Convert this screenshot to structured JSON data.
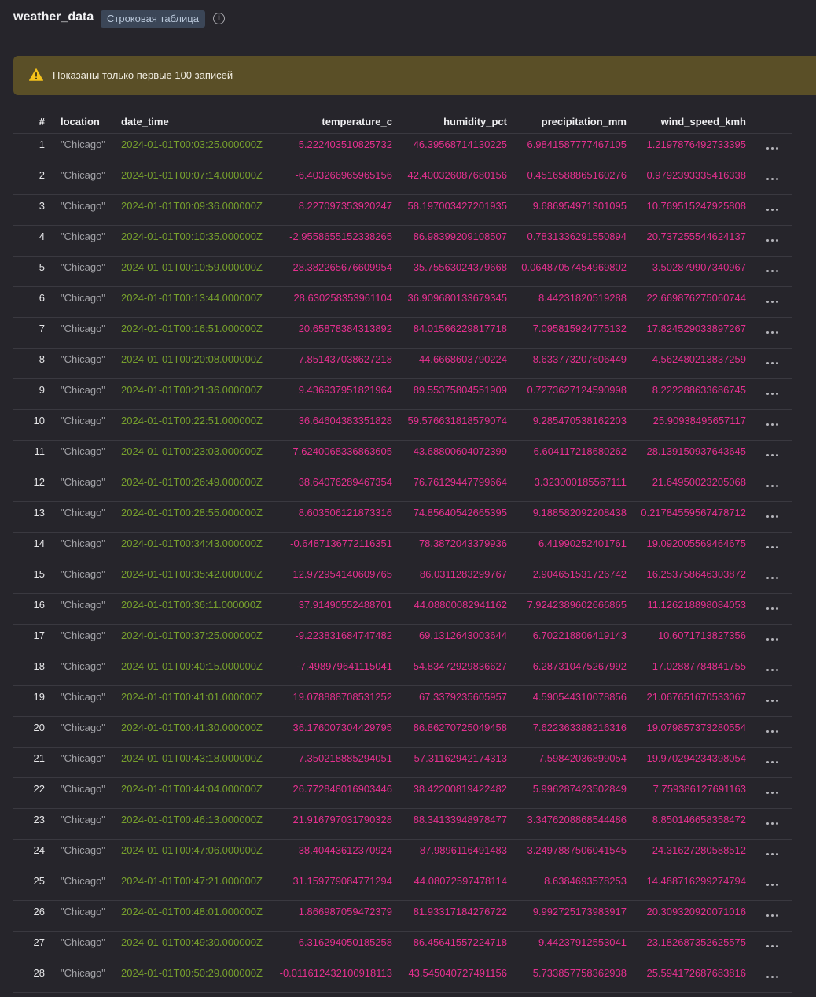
{
  "header": {
    "title": "weather_data",
    "badge": "Строковая таблица",
    "info_icon": "info-circle-icon"
  },
  "banner": {
    "icon": "warning-triangle-icon",
    "text": "Показаны только первые 100 записей",
    "color": "#5a4f27"
  },
  "colors": {
    "string": "#a3a3a8",
    "datetime": "#77a02d",
    "number": "#e5308f"
  },
  "table": {
    "columns": [
      "#",
      "location",
      "date_time",
      "temperature_c",
      "humidity_pct",
      "precipitation_mm",
      "wind_speed_kmh"
    ],
    "rows": [
      [
        "1",
        "\"Chicago\"",
        "2024-01-01T00:03:25.000000Z",
        "5.222403510825732",
        "46.39568714130225",
        "6.9841587777467105",
        "1.2197876492733395"
      ],
      [
        "2",
        "\"Chicago\"",
        "2024-01-01T00:07:14.000000Z",
        "-6.403266965965156",
        "42.400326087680156",
        "0.4516588865160276",
        "0.9792393335416338"
      ],
      [
        "3",
        "\"Chicago\"",
        "2024-01-01T00:09:36.000000Z",
        "8.227097353920247",
        "58.197003427201935",
        "9.686954971301095",
        "10.769515247925808"
      ],
      [
        "4",
        "\"Chicago\"",
        "2024-01-01T00:10:35.000000Z",
        "-2.9558655152338265",
        "86.98399209108507",
        "0.7831336291550894",
        "20.737255544624137"
      ],
      [
        "5",
        "\"Chicago\"",
        "2024-01-01T00:10:59.000000Z",
        "28.382265676609954",
        "35.75563024379668",
        "0.06487057454969802",
        "3.502879907340967"
      ],
      [
        "6",
        "\"Chicago\"",
        "2024-01-01T00:13:44.000000Z",
        "28.630258353961104",
        "36.909680133679345",
        "8.44231820519288",
        "22.669876275060744"
      ],
      [
        "7",
        "\"Chicago\"",
        "2024-01-01T00:16:51.000000Z",
        "20.65878384313892",
        "84.01566229817718",
        "7.095815924775132",
        "17.824529033897267"
      ],
      [
        "8",
        "\"Chicago\"",
        "2024-01-01T00:20:08.000000Z",
        "7.851437038627218",
        "44.6668603790224",
        "8.633773207606449",
        "4.562480213837259"
      ],
      [
        "9",
        "\"Chicago\"",
        "2024-01-01T00:21:36.000000Z",
        "9.436937951821964",
        "89.55375804551909",
        "0.7273627124590998",
        "8.222288633686745"
      ],
      [
        "10",
        "\"Chicago\"",
        "2024-01-01T00:22:51.000000Z",
        "36.64604383351828",
        "59.576631818579074",
        "9.285470538162203",
        "25.90938495657117"
      ],
      [
        "11",
        "\"Chicago\"",
        "2024-01-01T00:23:03.000000Z",
        "-7.6240068336863605",
        "43.68800604072399",
        "6.604117218680262",
        "28.139150937643645"
      ],
      [
        "12",
        "\"Chicago\"",
        "2024-01-01T00:26:49.000000Z",
        "38.64076289467354",
        "76.76129447799664",
        "3.323000185567111",
        "21.64950023205068"
      ],
      [
        "13",
        "\"Chicago\"",
        "2024-01-01T00:28:55.000000Z",
        "8.603506121873316",
        "74.85640542665395",
        "9.188582092208438",
        "0.21784559567478712"
      ],
      [
        "14",
        "\"Chicago\"",
        "2024-01-01T00:34:43.000000Z",
        "-0.6487136772116351",
        "78.3872043379936",
        "6.41990252401761",
        "19.092005569464675"
      ],
      [
        "15",
        "\"Chicago\"",
        "2024-01-01T00:35:42.000000Z",
        "12.972954140609765",
        "86.0311283299767",
        "2.904651531726742",
        "16.253758646303872"
      ],
      [
        "16",
        "\"Chicago\"",
        "2024-01-01T00:36:11.000000Z",
        "37.91490552488701",
        "44.08800082941162",
        "7.9242389602666865",
        "11.126218898084053"
      ],
      [
        "17",
        "\"Chicago\"",
        "2024-01-01T00:37:25.000000Z",
        "-9.223831684747482",
        "69.1312643003644",
        "6.702218806419143",
        "10.6071713827356"
      ],
      [
        "18",
        "\"Chicago\"",
        "2024-01-01T00:40:15.000000Z",
        "-7.498979641115041",
        "54.83472929836627",
        "6.287310475267992",
        "17.02887784841755"
      ],
      [
        "19",
        "\"Chicago\"",
        "2024-01-01T00:41:01.000000Z",
        "19.078888708531252",
        "67.3379235605957",
        "4.590544310078856",
        "21.067651670533067"
      ],
      [
        "20",
        "\"Chicago\"",
        "2024-01-01T00:41:30.000000Z",
        "36.176007304429795",
        "86.86270725049458",
        "7.622363388216316",
        "19.079857373280554"
      ],
      [
        "21",
        "\"Chicago\"",
        "2024-01-01T00:43:18.000000Z",
        "7.350218885294051",
        "57.31162942174313",
        "7.59842036899054",
        "19.970294234398054"
      ],
      [
        "22",
        "\"Chicago\"",
        "2024-01-01T00:44:04.000000Z",
        "26.772848016903446",
        "38.42200819422482",
        "5.996287423502849",
        "7.759386127691163"
      ],
      [
        "23",
        "\"Chicago\"",
        "2024-01-01T00:46:13.000000Z",
        "21.916797031790328",
        "88.34133948978477",
        "3.3476208868544486",
        "8.850146658358472"
      ],
      [
        "24",
        "\"Chicago\"",
        "2024-01-01T00:47:06.000000Z",
        "38.40443612370924",
        "87.9896116491483",
        "3.2497887506041545",
        "24.31627280588512"
      ],
      [
        "25",
        "\"Chicago\"",
        "2024-01-01T00:47:21.000000Z",
        "31.159779084771294",
        "44.08072597478114",
        "8.6384693578253",
        "14.488716299274794"
      ],
      [
        "26",
        "\"Chicago\"",
        "2024-01-01T00:48:01.000000Z",
        "1.866987059472379",
        "81.93317184276722",
        "9.992725173983917",
        "20.309320920071016"
      ],
      [
        "27",
        "\"Chicago\"",
        "2024-01-01T00:49:30.000000Z",
        "-6.316294050185258",
        "86.45641557224718",
        "9.44237912553041",
        "23.182687352625575"
      ],
      [
        "28",
        "\"Chicago\"",
        "2024-01-01T00:50:29.000000Z",
        "-0.011612432100918113",
        "43.545040727491156",
        "5.733857758362938",
        "25.594172687683816"
      ]
    ],
    "row_action_icon": "more-horizontal-icon"
  }
}
